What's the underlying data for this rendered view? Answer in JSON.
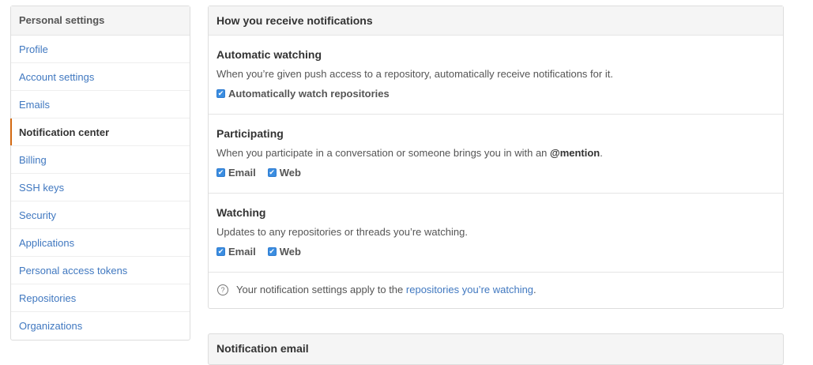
{
  "sidebar": {
    "title": "Personal settings",
    "items": [
      {
        "label": "Profile"
      },
      {
        "label": "Account settings"
      },
      {
        "label": "Emails"
      },
      {
        "label": "Notification center",
        "selected": true
      },
      {
        "label": "Billing"
      },
      {
        "label": "SSH keys"
      },
      {
        "label": "Security"
      },
      {
        "label": "Applications"
      },
      {
        "label": "Personal access tokens"
      },
      {
        "label": "Repositories"
      },
      {
        "label": "Organizations"
      }
    ]
  },
  "panel": {
    "title": "How you receive notifications",
    "automatic": {
      "title": "Automatic watching",
      "desc": "When you’re given push access to a repository, automatically receive notifications for it.",
      "option": "Automatically watch repositories"
    },
    "participating": {
      "title": "Participating",
      "desc_pre": "When you participate in a conversation or someone brings you in with an ",
      "desc_mention": "@mention",
      "desc_post": ".",
      "email": "Email",
      "web": "Web"
    },
    "watching": {
      "title": "Watching",
      "desc": "Updates to any repositories or threads you’re watching.",
      "email": "Email",
      "web": "Web"
    },
    "footer": {
      "text": "Your notification settings apply to the ",
      "link": "repositories you’re watching",
      "end": "."
    }
  },
  "panel2": {
    "title": "Notification email"
  },
  "icons": {
    "help": "question-circle-icon",
    "check": "checkbox-checked-icon"
  },
  "colors": {
    "link": "#4078c0",
    "selected_accent": "#d26911",
    "checkbox": "#3b8de0"
  }
}
